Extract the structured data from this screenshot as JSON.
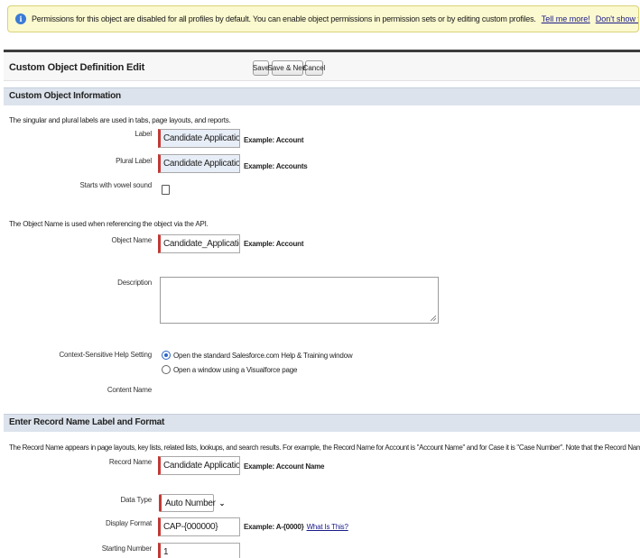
{
  "banner": {
    "message": "Permissions for this object are disabled for all profiles by default. You can enable object permissions in permission sets or by editing custom profiles.",
    "tell_me_more": "Tell me more!",
    "dont_show": "Don't show this message again",
    "icon": "info-icon"
  },
  "header": {
    "title": "Custom Object Definition Edit",
    "save": "Save",
    "save_new": "Save & New",
    "cancel": "Cancel"
  },
  "section1": {
    "title": "Custom Object Information",
    "labels_note": "The singular and plural labels are used in tabs, page layouts, and reports.",
    "label_label": "Label",
    "label_value": "Candidate Application",
    "label_example": "Example:  Account",
    "plural_label": "Plural Label",
    "plural_value": "Candidate Applications",
    "plural_example": "Example:  Accounts",
    "vowel_label": "Starts with vowel sound",
    "api_note": "The Object Name is used when referencing the object via the API.",
    "object_name_label": "Object Name",
    "object_name_value": "Candidate_Application",
    "object_name_example": "Example:  Account",
    "description_label": "Description",
    "help_label": "Context-Sensitive Help Setting",
    "help_option1": "Open the standard Salesforce.com Help & Training window",
    "help_option2": "Open a window using a Visualforce page",
    "content_name_label": "Content Name"
  },
  "section2": {
    "title": "Enter Record Name Label and Format",
    "note": "The Record Name appears in page layouts, key lists, related lists, lookups, and search results. For example, the Record Name for Account is \"Account Name\" and for Case it is \"Case Number\". Note that the Record Name field is always called \"Name\" when referenced via the API.",
    "record_name_label": "Record Name",
    "record_name_value": "Candidate Application Name",
    "record_name_example": "Example:  Account Name",
    "data_type_label": "Data Type",
    "data_type_value": "Auto Number",
    "display_format_label": "Display Format",
    "display_format_value": "CAP-{000000}",
    "display_format_example": "Example:  A-{0000}",
    "what_is_this": "What Is This?",
    "starting_number_label": "Starting Number",
    "starting_number_value": "1"
  }
}
